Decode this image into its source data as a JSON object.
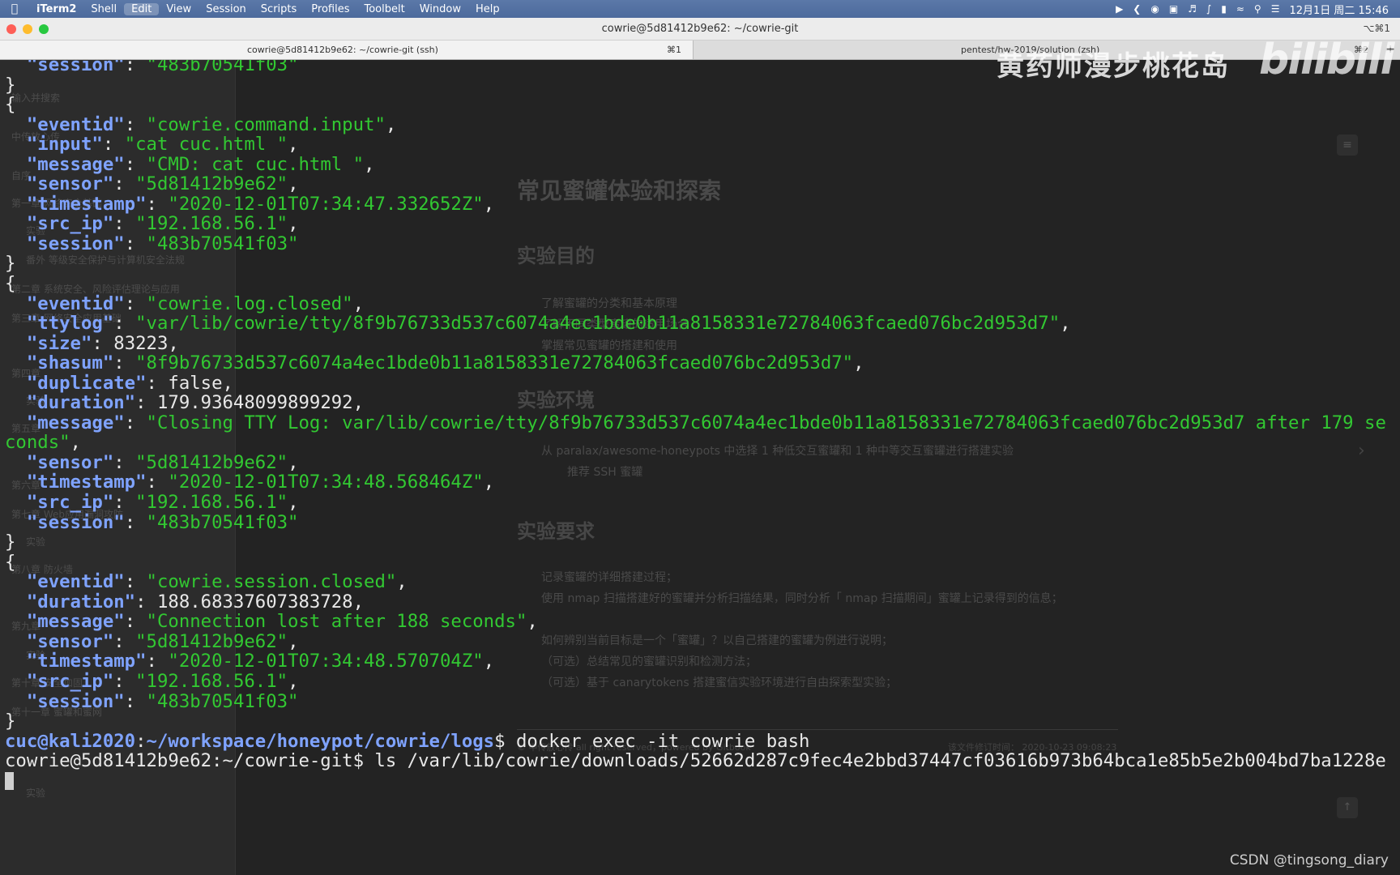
{
  "menubar": {
    "app": "iTerm2",
    "items": [
      "Shell",
      "Edit",
      "View",
      "Session",
      "Scripts",
      "Profiles",
      "Toolbelt",
      "Window",
      "Help"
    ],
    "clock": "12月1日 周二 15:46"
  },
  "window": {
    "title": "cowrie@5d81412b9e62: ~/cowrie-git",
    "shortcut": "⌥⌘1"
  },
  "tabs": [
    {
      "label": "cowrie@5d81412b9e62: ~/cowrie-git (ssh)",
      "shortcut": "⌘1"
    },
    {
      "label": "pentest/hw-2019/solution (zsh)",
      "shortcut": "⌘2"
    }
  ],
  "ghost_page": {
    "sidebar": [
      "输入并搜索",
      "中传放心传",
      "自序",
      "第一章 网络安全基础",
      "实验",
      "番外 等级安全保护与计算机安全法规",
      "第二章 系统安全、风险评估理论与应用",
      "第三章 网络安全应用基础",
      "第四章",
      "实验",
      "第五章",
      "第六章",
      "第七章 Web应用漏洞攻防",
      "实验",
      "第八章 防火墙",
      "第九章",
      "实验",
      "第十章 安全加固",
      "第十一章 蜜罐和蜜网",
      "实验"
    ],
    "h1": "常见蜜罐体验和探索",
    "h2_purpose": "实验目的",
    "purpose": [
      "了解蜜罐的分类和基本原理",
      "了解不同类型蜜罐的适用场合",
      "掌握常见蜜罐的搭建和使用"
    ],
    "h2_env": "实验环境",
    "env": [
      "从 paralax/awesome-honeypots 中选择 1 种低交互蜜罐和 1 种中等交互蜜罐进行搭建实验",
      "推荐 SSH 蜜罐"
    ],
    "h2_req": "实验要求",
    "req": [
      "记录蜜罐的详细搭建过程；",
      "使用 nmap 扫描搭建好的蜜罐并分析扫描结果，同时分析「 nmap 扫描期间」蜜罐上记录得到的信息；",
      "如何辨别当前目标是一个「蜜罐」？以自己搭建的蜜罐为例进行说明；",
      "（可选）总结常见的蜜罐识别和检测方法；",
      "（可选）基于 canarytokens 搭建蜜信实验环境进行自由探索型实验；"
    ],
    "footer_left": "© 中传放心传 all right reserved，powered by Gitbook",
    "footer_right": "该文件修订时间： 2020-10-23 09:08:23"
  },
  "terminal": {
    "blocks": [
      {
        "head": null,
        "fields": [
          [
            "session",
            "\"483b70541f03\"",
            "str"
          ]
        ]
      },
      {
        "head": "{",
        "fields": [
          [
            "eventid",
            "\"cowrie.command.input\"",
            "str"
          ],
          [
            "input",
            "\"cat cuc.html \"",
            "str"
          ],
          [
            "message",
            "\"CMD: cat cuc.html \"",
            "str"
          ],
          [
            "sensor",
            "\"5d81412b9e62\"",
            "str"
          ],
          [
            "timestamp",
            "\"2020-12-01T07:34:47.332652Z\"",
            "str"
          ],
          [
            "src_ip",
            "\"192.168.56.1\"",
            "str"
          ],
          [
            "session",
            "\"483b70541f03\"",
            "str"
          ]
        ]
      },
      {
        "head": "{",
        "fields": [
          [
            "eventid",
            "\"cowrie.log.closed\"",
            "str"
          ],
          [
            "ttylog",
            "\"var/lib/cowrie/tty/8f9b76733d537c6074a4ec1bde0b11a8158331e72784063fcaed076bc2d953d7\"",
            "str"
          ],
          [
            "size",
            "83223",
            "num"
          ],
          [
            "shasum",
            "\"8f9b76733d537c6074a4ec1bde0b11a8158331e72784063fcaed076bc2d953d7\"",
            "str"
          ],
          [
            "duplicate",
            "false",
            "num"
          ],
          [
            "duration",
            "179.93648099899292",
            "num"
          ],
          [
            "message",
            "\"Closing TTY Log: var/lib/cowrie/tty/8f9b76733d537c6074a4ec1bde0b11a8158331e72784063fcaed076bc2d953d7 after 179 se\nconds\"",
            "str"
          ],
          [
            "sensor",
            "\"5d81412b9e62\"",
            "str"
          ],
          [
            "timestamp",
            "\"2020-12-01T07:34:48.568464Z\"",
            "str"
          ],
          [
            "src_ip",
            "\"192.168.56.1\"",
            "str"
          ],
          [
            "session",
            "\"483b70541f03\"",
            "str"
          ]
        ]
      },
      {
        "head": "{",
        "fields": [
          [
            "eventid",
            "\"cowrie.session.closed\"",
            "str"
          ],
          [
            "duration",
            "188.68337607383728",
            "num"
          ],
          [
            "message",
            "\"Connection lost after 188 seconds\"",
            "str"
          ],
          [
            "sensor",
            "\"5d81412b9e62\"",
            "str"
          ],
          [
            "timestamp",
            "\"2020-12-01T07:34:48.570704Z\"",
            "str"
          ],
          [
            "src_ip",
            "\"192.168.56.1\"",
            "str"
          ],
          [
            "session",
            "\"483b70541f03\"",
            "str"
          ]
        ]
      }
    ],
    "prompt1": {
      "user": "cuc@kali2020",
      "path": "~/workspace/honeypot/cowrie/logs",
      "cmd": "docker exec -it cowrie bash"
    },
    "prompt2": {
      "text": "cowrie@5d81412b9e62:~/cowrie-git$ ls /var/lib/cowrie/downloads/52662d287c9fec4e2bbd37447cf03616b973b64bca1e85b5e2b004bd7ba1228e"
    }
  },
  "watermark": "黄药师漫步桃花岛",
  "logo": "bilibili",
  "credit": "CSDN @tingsong_diary"
}
